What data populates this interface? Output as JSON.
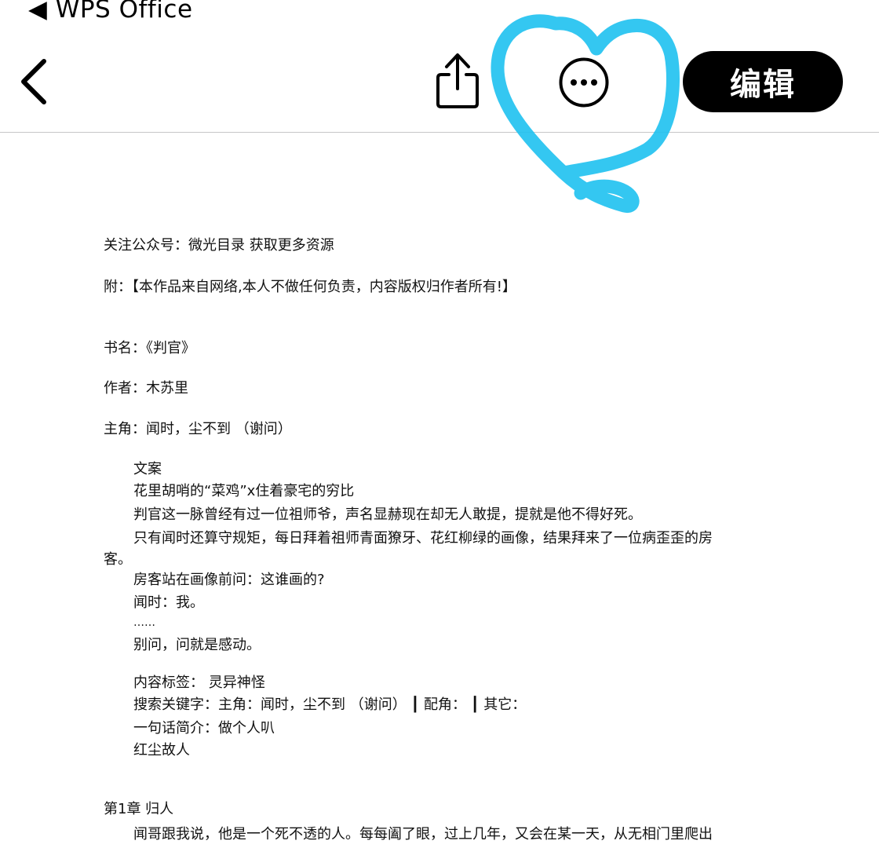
{
  "status_bar": {
    "back_label": "◀ WPS Office"
  },
  "toolbar": {
    "back_icon": "chevron-left-icon",
    "share_icon": "share-icon",
    "more_icon": "more-options-icon",
    "edit_label": "编辑"
  },
  "annotation": {
    "color": "#1ec1f0"
  },
  "document": {
    "lines": [
      "关注公众号：微光目录      获取更多资源",
      "附：【本作品来自网络,本人不做任何负责，内容版权归作者所有!】",
      "书名：《判官》",
      "作者：木苏里",
      "主角：闻时，尘不到 （谢问）",
      "文案",
      "花里胡哨的“菜鸡”x住着豪宅的穷比",
      "判官这一脉曾经有过一位祖师爷，声名显赫现在却无人敢提，提就是他不得好死。",
      "只有闻时还算守规矩，每日拜着祖师青面獠牙、花红柳绿的画像，结果拜来了一位病歪歪的房",
      "客。",
      "房客站在画像前问：这谁画的?",
      "闻时：我。",
      "……",
      "别问，问就是感动。",
      "内容标签： 灵异神怪",
      "搜索关键字：主角：闻时，尘不到 （谢问） ┃ 配角： ┃ 其它：",
      "一句话简介：做个人叭",
      "红尘故人",
      "第1章 归人",
      "闻哥跟我说，他是一个死不透的人。每每阖了眼，过上几年，又会在某一天，从无相门里爬出"
    ]
  }
}
